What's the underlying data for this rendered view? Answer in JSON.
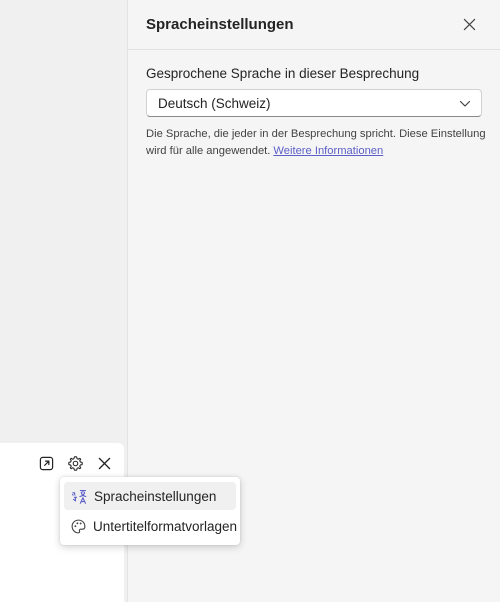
{
  "panel": {
    "title": "Spracheinstellungen",
    "close_icon": "close-icon",
    "field_label": "Gesprochene Sprache in dieser Besprechung",
    "select": {
      "value": "Deutsch (Schweiz)",
      "icon": "chevron-down-icon"
    },
    "help_text": "Die Sprache, die jeder in der Besprechung spricht. Diese Einstellung wird für alle angewendet.",
    "help_link": "Weitere Informationen"
  },
  "caption_toolbar": {
    "icons": [
      "pop-out-icon",
      "gear-icon",
      "close-icon"
    ]
  },
  "menu": {
    "items": [
      {
        "label": "Spracheinstellungen",
        "icon": "language-icon",
        "highlighted": true
      },
      {
        "label": "Untertitelformatvorlagen",
        "icon": "palette-icon",
        "highlighted": false
      }
    ]
  },
  "colors": {
    "accent": "#5b5fc7",
    "panel_bg": "#f5f5f5",
    "page_bg": "#f0f0f0",
    "text": "#242424"
  }
}
